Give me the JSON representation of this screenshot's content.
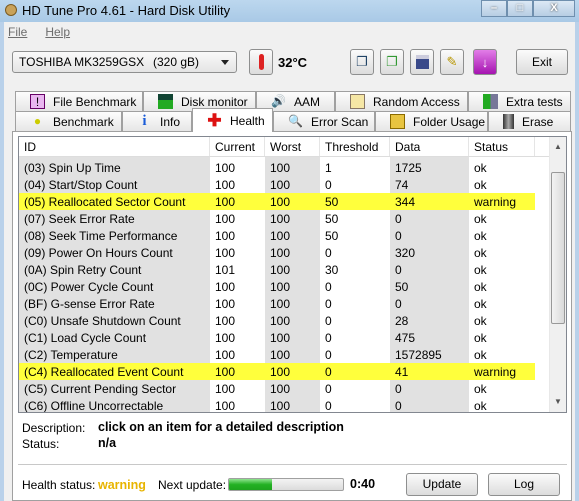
{
  "window": {
    "title": "HD Tune Pro 4.61 - Hard Disk Utility"
  },
  "menu": [
    "File",
    "Help"
  ],
  "toolbar": {
    "drive_name": "TOSHIBA MK3259GSX",
    "drive_capacity": "(320 gB)",
    "temperature": "32°C",
    "exit_label": "Exit"
  },
  "tabs_row1": [
    "File Benchmark",
    "Disk monitor",
    "AAM",
    "Random Access",
    "Extra tests"
  ],
  "tabs_row2": [
    "Benchmark",
    "Info",
    "Health",
    "Error Scan",
    "Folder Usage",
    "Erase"
  ],
  "active_tab": "Health",
  "table": {
    "headers": [
      "ID",
      "Current",
      "Worst",
      "Threshold",
      "Data",
      "Status"
    ],
    "rows": [
      [
        "(03) Spin Up Time",
        "100",
        "100",
        "1",
        "1725",
        "ok"
      ],
      [
        "(04) Start/Stop Count",
        "100",
        "100",
        "0",
        "74",
        "ok"
      ],
      [
        "(05) Reallocated Sector Count",
        "100",
        "100",
        "50",
        "344",
        "warning"
      ],
      [
        "(07) Seek Error Rate",
        "100",
        "100",
        "50",
        "0",
        "ok"
      ],
      [
        "(08) Seek Time Performance",
        "100",
        "100",
        "50",
        "0",
        "ok"
      ],
      [
        "(09) Power On Hours Count",
        "100",
        "100",
        "0",
        "320",
        "ok"
      ],
      [
        "(0A) Spin Retry Count",
        "101",
        "100",
        "30",
        "0",
        "ok"
      ],
      [
        "(0C) Power Cycle Count",
        "100",
        "100",
        "0",
        "50",
        "ok"
      ],
      [
        "(BF) G-sense Error Rate",
        "100",
        "100",
        "0",
        "0",
        "ok"
      ],
      [
        "(C0) Unsafe Shutdown Count",
        "100",
        "100",
        "0",
        "28",
        "ok"
      ],
      [
        "(C1) Load Cycle Count",
        "100",
        "100",
        "0",
        "475",
        "ok"
      ],
      [
        "(C2) Temperature",
        "100",
        "100",
        "0",
        "1572895",
        "ok"
      ],
      [
        "(C4) Reallocated Event Count",
        "100",
        "100",
        "0",
        "41",
        "warning"
      ],
      [
        "(C5) Current Pending Sector",
        "100",
        "100",
        "0",
        "0",
        "ok"
      ],
      [
        "(C6) Offline Uncorrectable",
        "100",
        "100",
        "0",
        "0",
        "ok"
      ]
    ]
  },
  "details": {
    "description_label": "Description:",
    "description_value": "click on an item for a detailed description",
    "status_label": "Status:",
    "status_value": "n/a"
  },
  "footer": {
    "health_label": "Health status:",
    "health_value": "warning",
    "next_update_label": "Next update:",
    "progress_percent": 38,
    "countdown": "0:40",
    "update_label": "Update",
    "log_label": "Log"
  },
  "colors": {
    "warning_highlight": "#ffff3c",
    "warning_text": "#e8b400",
    "progress": "#23b123"
  }
}
